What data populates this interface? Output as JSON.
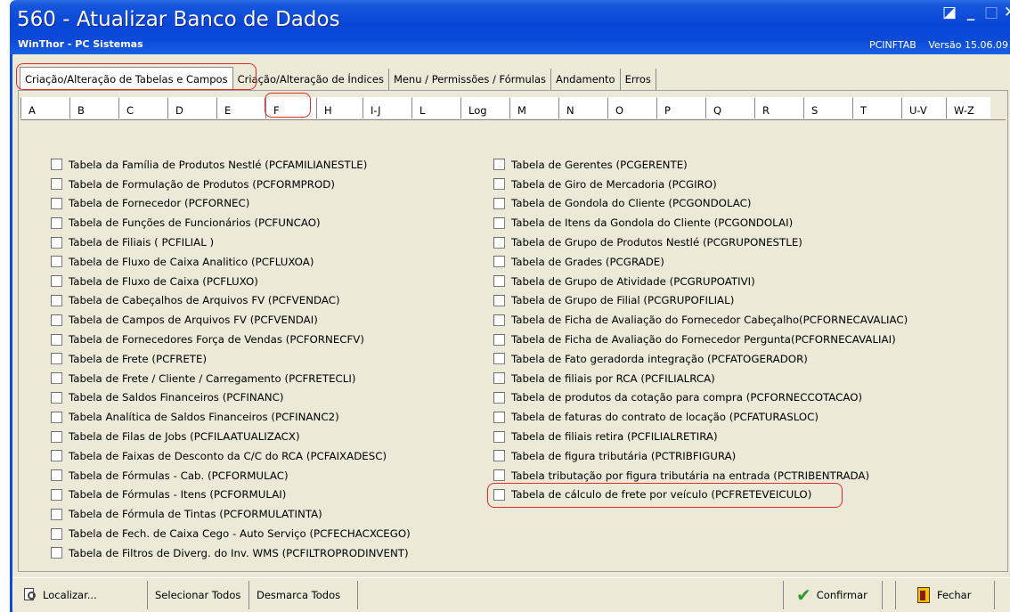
{
  "window": {
    "title": "560 - Atualizar Banco de Dados",
    "subtitle": "WinThor - PC Sistemas",
    "module": "PCINFTAB",
    "version": "Versão 15.06.09"
  },
  "top_tabs": [
    {
      "label": "Criação/Alteração de Tabelas e Campos",
      "active": true
    },
    {
      "label": "Criação/Alteração de Índices",
      "active": false
    },
    {
      "label": "Menu / Permissões / Fórmulas",
      "active": false
    },
    {
      "label": "Andamento",
      "active": false
    },
    {
      "label": "Erros",
      "active": false
    }
  ],
  "letter_tabs": [
    "A",
    "B",
    "C",
    "D",
    "E",
    "F",
    "H",
    "I-J",
    "L",
    "Log",
    "M",
    "N",
    "O",
    "P",
    "Q",
    "R",
    "S",
    "T",
    "U-V",
    "W-Z"
  ],
  "active_letter": "F",
  "left_items": [
    "Tabela da Família de Produtos Nestlé (PCFAMILIANESTLE)",
    "Tabela de Formulação de Produtos  (PCFORMPROD)",
    "Tabela de Fornecedor  (PCFORNEC)",
    "Tabela de Funções de Funcionários  (PCFUNCAO)",
    "Tabela de Filiais ( PCFILIAL )",
    "Tabela de Fluxo de Caixa Analitico (PCFLUXOA)",
    "Tabela de Fluxo de Caixa (PCFLUXO)",
    "Tabela de Cabeçalhos de Arquivos FV (PCFVENDAC)",
    "Tabela de Campos de Arquivos FV (PCFVENDAI)",
    "Tabela de Fornecedores Força de Vendas (PCFORNECFV)",
    "Tabela de Frete (PCFRETE)",
    "Tabela de Frete / Cliente / Carregamento (PCFRETECLI)",
    "Tabela de Saldos Financeiros (PCFINANC)",
    "Tabela Analítica de Saldos Financeiros (PCFINANC2)",
    "Tabela de Filas de Jobs (PCFILAATUALIZACX)",
    "Tabela de Faixas de Desconto da C/C do RCA (PCFAIXADESC)",
    "Tabela de Fórmulas - Cab. (PCFORMULAC)",
    "Tabela de Fórmulas - Itens (PCFORMULAI)",
    "Tabela de Fórmula de Tintas (PCFORMULATINTA)",
    "Tabela de Fech. de Caixa Cego - Auto Serviço (PCFECHACXCEGO)",
    "Tabela de Filtros de Diverg. do Inv. WMS (PCFILTROPRODINVENT)"
  ],
  "right_items": [
    "Tabela de Gerentes (PCGERENTE)",
    "Tabela de Giro de Mercadoria (PCGIRO)",
    "Tabela de Gondola do Cliente (PCGONDOLAC)",
    "Tabela de Itens da Gondola do Cliente (PCGONDOLAI)",
    "Tabela de Grupo de Produtos Nestlé (PCGRUPONESTLE)",
    "Tabela de Grades (PCGRADE)",
    "Tabela de Grupo de Atividade (PCGRUPOATIVI)",
    "Tabela de Grupo de Filial (PCGRUPOFILIAL)",
    "Tabela de Ficha de Avaliação do Fornecedor Cabeçalho(PCFORNECAVALIAC)",
    "Tabela de Ficha de Avaliação do Fornecedor Pergunta(PCFORNECAVALIAI)",
    "Tabela de Fato geradorda integração (PCFATOGERADOR)",
    "Tabela de filiais por RCA (PCFILIALRCA)",
    "Tabela de produtos da cotação para compra (PCFORNECCOTACAO)",
    "Tabela de faturas do contrato de locação (PCFATURASLOC)",
    "Tabela de filiais retira (PCFILIALRETIRA)",
    "Tabela de figura tributária (PCTRIBFIGURA)",
    "Tabela tributação por figura tributária na entrada (PCTRIBENTRADA)",
    "Tabela de cálculo de frete por veículo (PCFRETEVEICULO)"
  ],
  "toolbar": {
    "localizar": "Localizar...",
    "selecionar": "Selecionar Todos",
    "desmarca": "Desmarca Todos",
    "confirmar": "Confirmar",
    "fechar": "Fechar"
  },
  "colors": {
    "titlebar": "#0b4bd8",
    "highlight_ring": "#e52a2a",
    "panel": "#ece9d8"
  }
}
